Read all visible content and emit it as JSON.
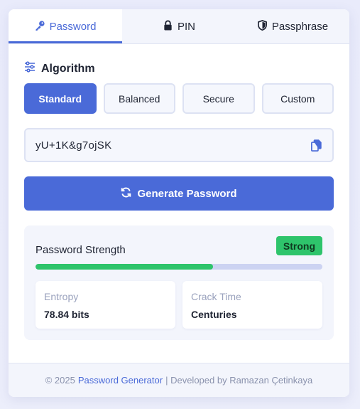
{
  "tabs": [
    {
      "label": "Password",
      "icon": "key-icon",
      "active": true
    },
    {
      "label": "PIN",
      "icon": "lock-icon",
      "active": false
    },
    {
      "label": "Passphrase",
      "icon": "shield-icon",
      "active": false
    }
  ],
  "algorithm": {
    "title": "Algorithm",
    "options": [
      "Standard",
      "Balanced",
      "Secure",
      "Custom"
    ],
    "selected": "Standard"
  },
  "password": {
    "value": "yU+1K&g7ojSK",
    "copy_icon": "copy-icon"
  },
  "generate_button": {
    "label": "Generate Password",
    "icon": "refresh-icon"
  },
  "strength": {
    "label": "Password Strength",
    "badge": "Strong",
    "progress_percent": 62,
    "entropy_label": "Entropy",
    "entropy_value": "78.84 bits",
    "crack_label": "Crack Time",
    "crack_value": "Centuries"
  },
  "footer": {
    "prefix": "© 2025",
    "link": "Password Generator",
    "suffix": "| Developed by Ramazan Çetinkaya"
  },
  "colors": {
    "accent": "#4a6ad8",
    "strong": "#2ec46b",
    "track": "#ccd3f2"
  }
}
